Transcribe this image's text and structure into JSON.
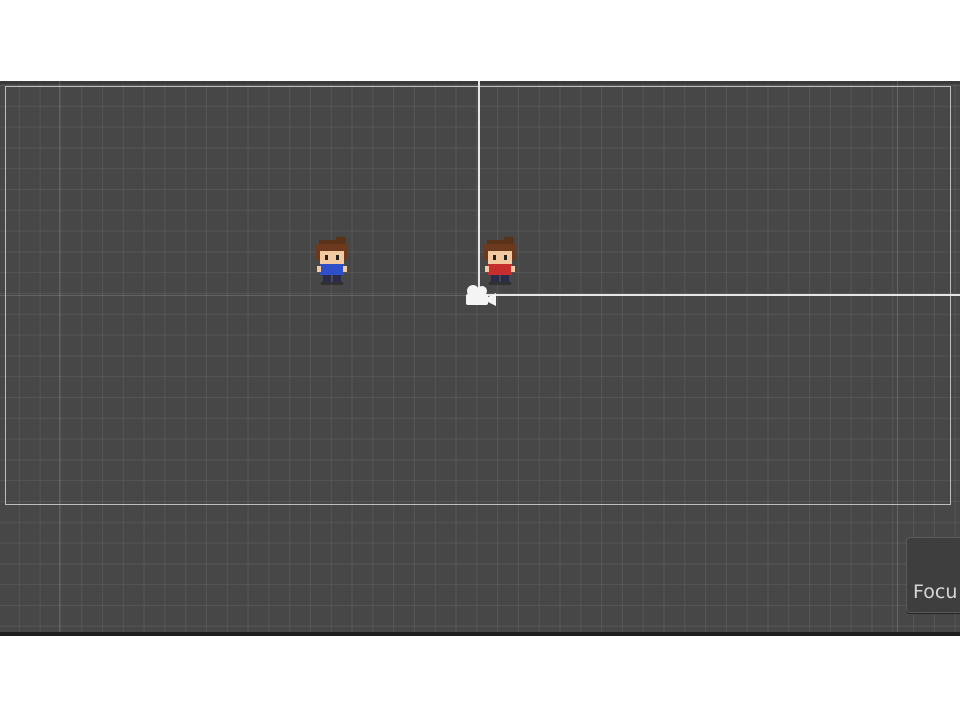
{
  "scene_view": {
    "grid": true,
    "colors": {
      "background": "#474747",
      "grid_line": "#5a5a5a",
      "camera_bounds": "#bdbdbd",
      "axis": "#e6e6e6"
    }
  },
  "gameobjects": [
    {
      "name": "blue-shirt-character",
      "icon": "character-sprite-blue",
      "shirt_color": "#2f4fc8"
    },
    {
      "name": "red-shirt-character",
      "icon": "character-sprite-red",
      "shirt_color": "#c62e2e"
    }
  ],
  "gizmos": {
    "camera_icon": "camera-icon"
  },
  "overlay": {
    "focus_label": "Focu"
  }
}
